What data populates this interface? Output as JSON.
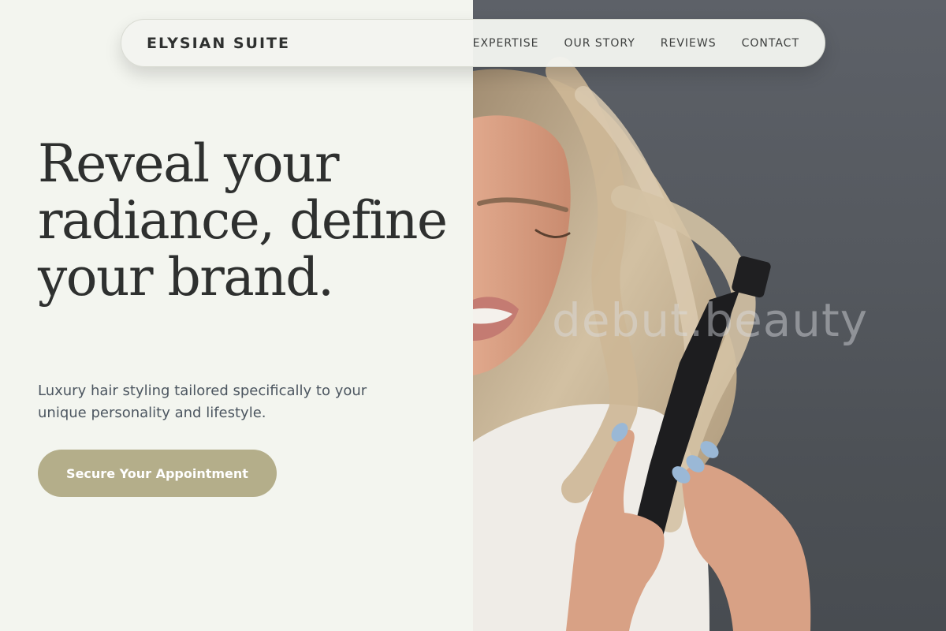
{
  "nav": {
    "brand": "ELYSIAN SUITE",
    "links": [
      "EXPERTISE",
      "OUR STORY",
      "REVIEWS",
      "CONTACT"
    ]
  },
  "hero": {
    "headline": "Reveal your radiance, define your brand.",
    "subtitle": "Luxury hair styling tailored specifically to your unique personality and lifestyle.",
    "cta_label": "Secure Your Appointment",
    "image_watermark": "debut.beauty"
  },
  "colors": {
    "background": "#f3f5ef",
    "accent": "#b4ae8a",
    "heading": "#2e302f",
    "body_text": "#4c5660",
    "photo_backdrop": "#55595f",
    "nail_polish": "#9ab8d6"
  },
  "icons": {
    "hero_image": "woman-curling-hair-photo"
  }
}
